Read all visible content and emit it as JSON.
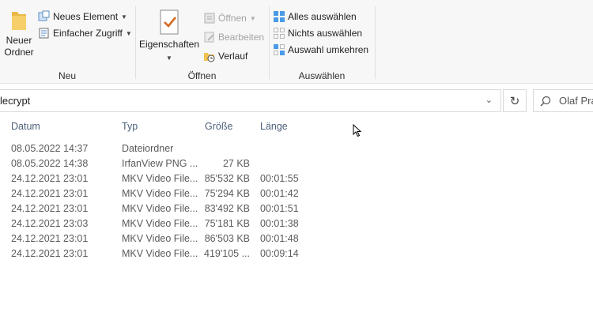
{
  "ribbon": {
    "neu": {
      "label": "Neu",
      "new_folder": "Neuer Ordner",
      "new_item": "Neues Element",
      "easy_access": "Einfacher Zugriff"
    },
    "oeffnen": {
      "label": "Öffnen",
      "properties": "Eigenschaften",
      "open": "Öffnen",
      "edit": "Bearbeiten",
      "history": "Verlauf"
    },
    "auswaehlen": {
      "label": "Auswählen",
      "select_all": "Alles auswählen",
      "select_none": "Nichts auswählen",
      "invert_selection": "Auswahl umkehren"
    }
  },
  "address": {
    "path": "lecrypt",
    "search_placeholder": "Olaf Pra"
  },
  "columns": {
    "date": "Datum",
    "type": "Typ",
    "size": "Größe",
    "length": "Länge"
  },
  "rows": [
    {
      "date": "08.05.2022 14:37",
      "type": "Dateiordner",
      "size": "",
      "length": ""
    },
    {
      "date": "08.05.2022 14:38",
      "type": "IrfanView PNG ...",
      "size": "27 KB",
      "length": ""
    },
    {
      "date": "24.12.2021 23:01",
      "type": "MKV Video File...",
      "size": "85'532 KB",
      "length": "00:01:55"
    },
    {
      "date": "24.12.2021 23:01",
      "type": "MKV Video File...",
      "size": "75'294 KB",
      "length": "00:01:42"
    },
    {
      "date": "24.12.2021 23:01",
      "type": "MKV Video File...",
      "size": "83'492 KB",
      "length": "00:01:51"
    },
    {
      "date": "24.12.2021 23:03",
      "type": "MKV Video File...",
      "size": "75'181 KB",
      "length": "00:01:38"
    },
    {
      "date": "24.12.2021 23:01",
      "type": "MKV Video File...",
      "size": "86'503 KB",
      "length": "00:01:48"
    },
    {
      "date": "24.12.2021 23:01",
      "type": "MKV Video File...",
      "size": "419'105 ...",
      "length": "00:09:14"
    }
  ]
}
